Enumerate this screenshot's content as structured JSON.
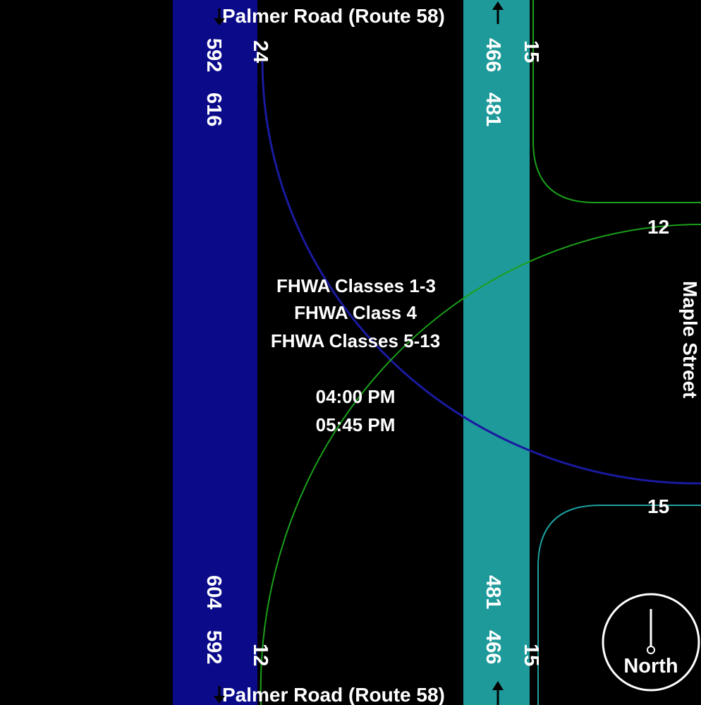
{
  "streets": {
    "north_label": "Palmer Road (Route 58)",
    "south_label": "Palmer Road (Route 58)",
    "east_label": "Maple Street"
  },
  "legend": {
    "classes_1_3": "FHWA Classes 1-3",
    "class_4": "FHWA Class 4",
    "classes_5_13": "FHWA Classes 5-13"
  },
  "time_range": {
    "start": "04:00 PM",
    "end": "05:45 PM"
  },
  "counts": {
    "north_southbound": {
      "total_a": "592",
      "total_b": "616",
      "right_turn": "24"
    },
    "north_northbound": {
      "total_a": "466",
      "total_b": "481",
      "turn": "15"
    },
    "south_southbound": {
      "total_a": "592",
      "total_b": "604",
      "left_turn": "12"
    },
    "south_northbound": {
      "total_a": "466",
      "total_b": "481",
      "turn": "15"
    },
    "east_upper": "12",
    "east_lower": "15"
  },
  "compass": {
    "label": "North"
  },
  "colors": {
    "background": "#000000",
    "southbound_band": "#0b0b8a",
    "northbound_band": "#1f9a9a",
    "turn_blue": "#1a1aa0",
    "turn_green": "#1aa01a",
    "turn_teal": "#1fa0a0"
  }
}
